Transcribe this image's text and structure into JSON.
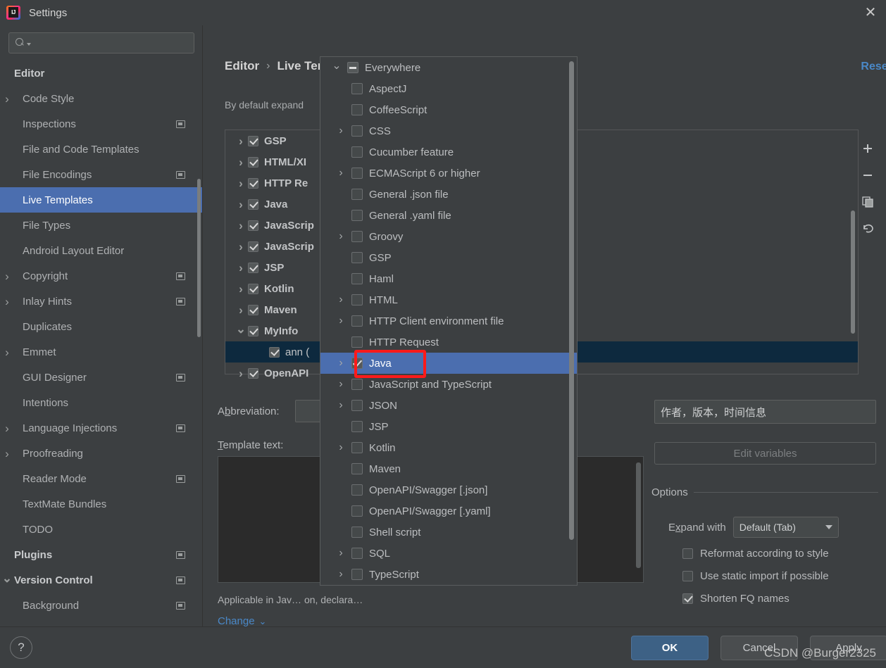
{
  "window": {
    "title": "Settings",
    "logo_icon": "intellij-idea-logo",
    "close_icon": "close-icon"
  },
  "search": {
    "value": "",
    "placeholder": "",
    "icon": "search-icon"
  },
  "sidebar": {
    "items": [
      {
        "label": "Editor",
        "bold": true,
        "chevron": "none",
        "indent": 0,
        "badge": false,
        "selected": false
      },
      {
        "label": "Code Style",
        "bold": false,
        "chevron": "right",
        "indent": 1,
        "badge": false,
        "selected": false
      },
      {
        "label": "Inspections",
        "bold": false,
        "chevron": "none",
        "indent": 1,
        "badge": true,
        "selected": false
      },
      {
        "label": "File and Code Templates",
        "bold": false,
        "chevron": "none",
        "indent": 1,
        "badge": false,
        "selected": false
      },
      {
        "label": "File Encodings",
        "bold": false,
        "chevron": "none",
        "indent": 1,
        "badge": true,
        "selected": false
      },
      {
        "label": "Live Templates",
        "bold": false,
        "chevron": "none",
        "indent": 1,
        "badge": false,
        "selected": true
      },
      {
        "label": "File Types",
        "bold": false,
        "chevron": "none",
        "indent": 1,
        "badge": false,
        "selected": false
      },
      {
        "label": "Android Layout Editor",
        "bold": false,
        "chevron": "none",
        "indent": 1,
        "badge": false,
        "selected": false
      },
      {
        "label": "Copyright",
        "bold": false,
        "chevron": "right",
        "indent": 1,
        "badge": true,
        "selected": false
      },
      {
        "label": "Inlay Hints",
        "bold": false,
        "chevron": "right",
        "indent": 1,
        "badge": true,
        "selected": false
      },
      {
        "label": "Duplicates",
        "bold": false,
        "chevron": "none",
        "indent": 1,
        "badge": false,
        "selected": false
      },
      {
        "label": "Emmet",
        "bold": false,
        "chevron": "right",
        "indent": 1,
        "badge": false,
        "selected": false
      },
      {
        "label": "GUI Designer",
        "bold": false,
        "chevron": "none",
        "indent": 1,
        "badge": true,
        "selected": false
      },
      {
        "label": "Intentions",
        "bold": false,
        "chevron": "none",
        "indent": 1,
        "badge": false,
        "selected": false
      },
      {
        "label": "Language Injections",
        "bold": false,
        "chevron": "right",
        "indent": 1,
        "badge": true,
        "selected": false
      },
      {
        "label": "Proofreading",
        "bold": false,
        "chevron": "right",
        "indent": 1,
        "badge": false,
        "selected": false
      },
      {
        "label": "Reader Mode",
        "bold": false,
        "chevron": "none",
        "indent": 1,
        "badge": true,
        "selected": false
      },
      {
        "label": "TextMate Bundles",
        "bold": false,
        "chevron": "none",
        "indent": 1,
        "badge": false,
        "selected": false
      },
      {
        "label": "TODO",
        "bold": false,
        "chevron": "none",
        "indent": 1,
        "badge": false,
        "selected": false
      },
      {
        "label": "Plugins",
        "bold": true,
        "chevron": "none",
        "indent": 0,
        "badge": true,
        "selected": false
      },
      {
        "label": "Version Control",
        "bold": true,
        "chevron": "down",
        "indent": 0,
        "badge": true,
        "selected": false
      },
      {
        "label": "Background",
        "bold": false,
        "chevron": "none",
        "indent": 1,
        "badge": true,
        "selected": false
      }
    ]
  },
  "main": {
    "breadcrumb": {
      "parent": "Editor",
      "separator": "›",
      "current": "Live Templates"
    },
    "reset_label": "Reset",
    "by_default_text": "By default expand",
    "template_tree": [
      {
        "label": "GSP",
        "checked": true,
        "chevron": "right",
        "child": false,
        "selected": false
      },
      {
        "label": "HTML/XI",
        "checked": true,
        "chevron": "right",
        "child": false,
        "selected": false
      },
      {
        "label": "HTTP Re",
        "checked": true,
        "chevron": "right",
        "child": false,
        "selected": false
      },
      {
        "label": "Java",
        "checked": true,
        "chevron": "right",
        "child": false,
        "selected": false
      },
      {
        "label": "JavaScrip",
        "checked": true,
        "chevron": "right",
        "child": false,
        "selected": false
      },
      {
        "label": "JavaScrip",
        "checked": true,
        "chevron": "right",
        "child": false,
        "selected": false
      },
      {
        "label": "JSP",
        "checked": true,
        "chevron": "right",
        "child": false,
        "selected": false
      },
      {
        "label": "Kotlin",
        "checked": true,
        "chevron": "right",
        "child": false,
        "selected": false
      },
      {
        "label": "Maven",
        "checked": true,
        "chevron": "right",
        "child": false,
        "selected": false
      },
      {
        "label": "MyInfo",
        "checked": true,
        "chevron": "down",
        "child": false,
        "selected": false
      },
      {
        "label": "ann (",
        "checked": true,
        "chevron": "none",
        "child": true,
        "selected": true
      },
      {
        "label": "OpenAPI",
        "checked": true,
        "chevron": "right",
        "child": false,
        "selected": false
      }
    ],
    "toolbar": [
      {
        "icon": "plus-icon",
        "label": "+"
      },
      {
        "icon": "minus-icon",
        "label": "−"
      },
      {
        "icon": "copy-icon",
        "label": ""
      },
      {
        "icon": "revert-icon",
        "label": ""
      }
    ],
    "abbreviation_label": "Abbreviation:",
    "abbreviation_value": "",
    "description_value": "作者，版本，时间信息",
    "template_text_label": "Template text:",
    "template_text_value": "",
    "applicable_text": "Applicable in Jav… on, declara…",
    "change_label": "Change",
    "change_caret": "⌄"
  },
  "options": {
    "edit_variables_label": "Edit variables",
    "section_title": "Options",
    "expand_with_label": "Expand with",
    "expand_with_value": "Default (Tab)",
    "checkboxes": [
      {
        "label": "Reformat according to style",
        "underline": "R",
        "checked": false
      },
      {
        "label": "Use static import if possible",
        "underline": "i",
        "checked": false
      },
      {
        "label": "Shorten FQ names",
        "underline": "F",
        "checked": true
      }
    ]
  },
  "popup": {
    "items": [
      {
        "label": "Everywhere",
        "chevron": "down",
        "state": "partial",
        "indent": 0,
        "selected": false
      },
      {
        "label": "AspectJ",
        "chevron": "none",
        "state": "off",
        "indent": 1,
        "selected": false
      },
      {
        "label": "CoffeeScript",
        "chevron": "none",
        "state": "off",
        "indent": 1,
        "selected": false
      },
      {
        "label": "CSS",
        "chevron": "right",
        "state": "off",
        "indent": 1,
        "selected": false
      },
      {
        "label": "Cucumber feature",
        "chevron": "none",
        "state": "off",
        "indent": 1,
        "selected": false
      },
      {
        "label": "ECMAScript 6 or higher",
        "chevron": "right",
        "state": "off",
        "indent": 1,
        "selected": false
      },
      {
        "label": "General .json file",
        "chevron": "none",
        "state": "off",
        "indent": 1,
        "selected": false
      },
      {
        "label": "General .yaml file",
        "chevron": "none",
        "state": "off",
        "indent": 1,
        "selected": false
      },
      {
        "label": "Groovy",
        "chevron": "right",
        "state": "off",
        "indent": 1,
        "selected": false
      },
      {
        "label": "GSP",
        "chevron": "none",
        "state": "off",
        "indent": 1,
        "selected": false
      },
      {
        "label": "Haml",
        "chevron": "none",
        "state": "off",
        "indent": 1,
        "selected": false
      },
      {
        "label": "HTML",
        "chevron": "right",
        "state": "off",
        "indent": 1,
        "selected": false
      },
      {
        "label": "HTTP Client environment file",
        "chevron": "right",
        "state": "off",
        "indent": 1,
        "selected": false
      },
      {
        "label": "HTTP Request",
        "chevron": "none",
        "state": "off",
        "indent": 1,
        "selected": false
      },
      {
        "label": "Java",
        "chevron": "right",
        "state": "on",
        "indent": 1,
        "selected": true
      },
      {
        "label": "JavaScript and TypeScript",
        "chevron": "right",
        "state": "off",
        "indent": 1,
        "selected": false
      },
      {
        "label": "JSON",
        "chevron": "right",
        "state": "off",
        "indent": 1,
        "selected": false
      },
      {
        "label": "JSP",
        "chevron": "none",
        "state": "off",
        "indent": 1,
        "selected": false
      },
      {
        "label": "Kotlin",
        "chevron": "right",
        "state": "off",
        "indent": 1,
        "selected": false
      },
      {
        "label": "Maven",
        "chevron": "none",
        "state": "off",
        "indent": 1,
        "selected": false
      },
      {
        "label": "OpenAPI/Swagger [.json]",
        "chevron": "none",
        "state": "off",
        "indent": 1,
        "selected": false
      },
      {
        "label": "OpenAPI/Swagger [.yaml]",
        "chevron": "none",
        "state": "off",
        "indent": 1,
        "selected": false
      },
      {
        "label": "Shell script",
        "chevron": "none",
        "state": "off",
        "indent": 1,
        "selected": false
      },
      {
        "label": "SQL",
        "chevron": "right",
        "state": "off",
        "indent": 1,
        "selected": false
      },
      {
        "label": "TypeScript",
        "chevron": "right",
        "state": "off",
        "indent": 1,
        "selected": false
      }
    ]
  },
  "footer": {
    "help_label": "?",
    "ok_label": "OK",
    "cancel_label": "Cancel",
    "apply_label": "Apply"
  },
  "watermark": {
    "text": "CSDN @Burger2325"
  },
  "colors": {
    "accent_selection": "#4b6eaf",
    "tree_selection": "#0d293e",
    "link": "#4a88c7",
    "annotation": "#ff1a1a",
    "window_bg": "#3c3f41",
    "editor_bg": "#2b2b2b",
    "ok_button": "#3d6185"
  }
}
